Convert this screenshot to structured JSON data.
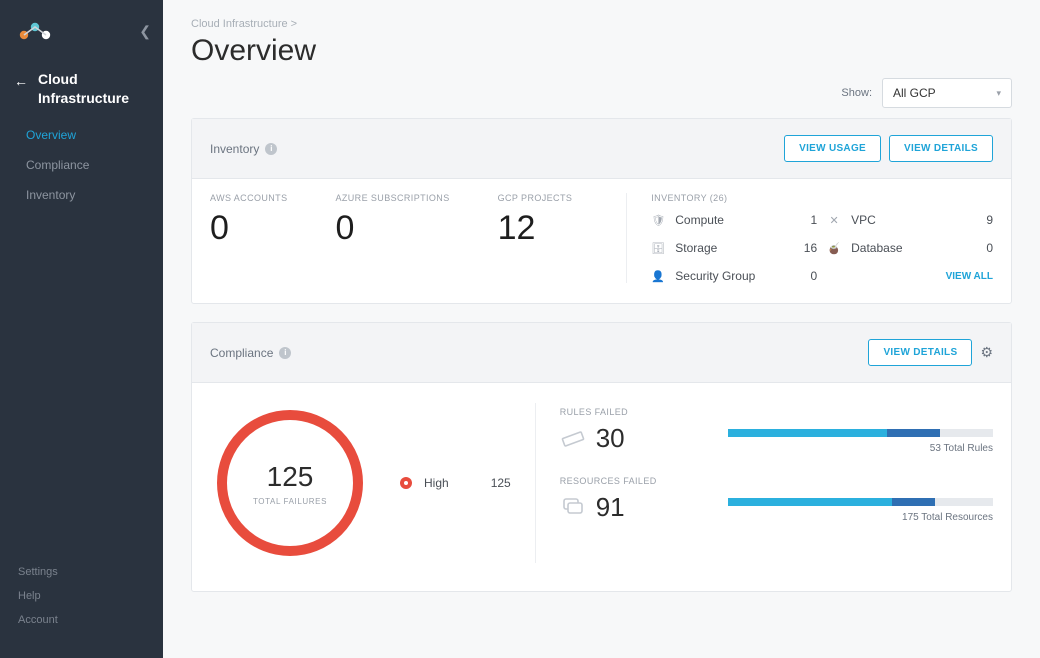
{
  "sidebar": {
    "section_title": "Cloud Infrastructure",
    "nav": [
      "Overview",
      "Compliance",
      "Inventory"
    ],
    "bottom": [
      "Settings",
      "Help",
      "Account"
    ]
  },
  "breadcrumb": "Cloud Infrastructure  >",
  "page_title": "Overview",
  "show_label": "Show:",
  "show_value": "All GCP",
  "inventory": {
    "title": "Inventory",
    "view_usage": "VIEW USAGE",
    "view_details": "VIEW DETAILS",
    "counts": [
      {
        "label": "AWS ACCOUNTS",
        "value": "0"
      },
      {
        "label": "AZURE SUBSCRIPTIONS",
        "value": "0"
      },
      {
        "label": "GCP PROJECTS",
        "value": "12"
      }
    ],
    "inventory_header": "INVENTORY (26)",
    "items": [
      {
        "icon": "shield-icon",
        "glyph": "🛡",
        "name": "Compute",
        "value": "1"
      },
      {
        "icon": "network-icon",
        "glyph": "✕",
        "name": "VPC",
        "value": "9"
      },
      {
        "icon": "storage-icon",
        "glyph": "🗄",
        "name": "Storage",
        "value": "16"
      },
      {
        "icon": "database-icon",
        "glyph": "🧉",
        "name": "Database",
        "value": "0"
      },
      {
        "icon": "security-group-icon",
        "glyph": "👤",
        "name": "Security Group",
        "value": "0"
      }
    ],
    "view_all": "VIEW ALL"
  },
  "compliance": {
    "title": "Compliance",
    "view_details": "VIEW DETAILS",
    "total_failures": "125",
    "total_failures_label": "TOTAL FAILURES",
    "legend_label": "High",
    "legend_value": "125",
    "rules_failed_label": "RULES FAILED",
    "rules_failed_value": "30",
    "rules_total": "53 Total Rules",
    "resources_failed_label": "RESOURCES FAILED",
    "resources_failed_value": "91",
    "resources_total": "175 Total Resources"
  },
  "chart_data": [
    {
      "type": "pie",
      "title": "Total Failures",
      "series": [
        {
          "name": "High",
          "value": 125,
          "color": "#e84c3d"
        }
      ],
      "total": 125
    },
    {
      "type": "bar",
      "title": "Rules Failed",
      "categories": [
        "Failed",
        "Total"
      ],
      "values": [
        30,
        53
      ],
      "ylim": [
        0,
        53
      ]
    },
    {
      "type": "bar",
      "title": "Resources Failed",
      "categories": [
        "Failed",
        "Total"
      ],
      "values": [
        91,
        175
      ],
      "ylim": [
        0,
        175
      ]
    }
  ]
}
